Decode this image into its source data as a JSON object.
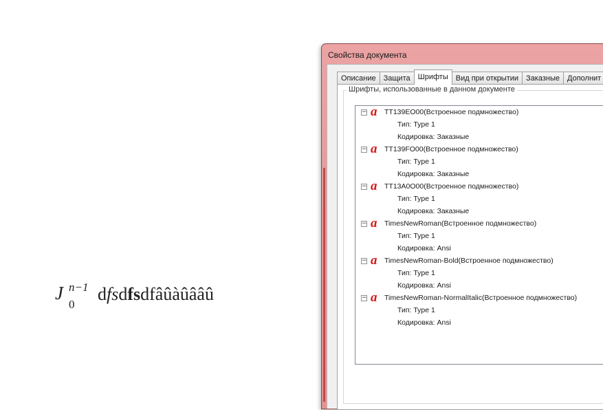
{
  "document": {
    "formula_base": "J",
    "formula_sup": "n−1",
    "formula_sub": "0",
    "text_d1": "d",
    "text_fs_italic": "fs",
    "text_d2": "d",
    "text_fs_bold": "fs",
    "text_rest": "dfâûàûââû"
  },
  "window": {
    "title": "Свойства документа"
  },
  "tabs": [
    {
      "label": "Описание"
    },
    {
      "label": "Защита"
    },
    {
      "label": "Шрифты"
    },
    {
      "label": "Вид при открытии"
    },
    {
      "label": "Заказные"
    },
    {
      "label": "Дополнит"
    }
  ],
  "active_tab": "Шрифты",
  "groupbox": {
    "caption": "Шрифты, использованные в данном документе"
  },
  "fonts": [
    {
      "name": "TT139EO00(Встроенное подмножество)",
      "type": "Тип: Type 1",
      "encoding": "Кодировка: Заказные"
    },
    {
      "name": "TT139FO00(Встроенное подмножество)",
      "type": "Тип: Type 1",
      "encoding": "Кодировка: Заказные"
    },
    {
      "name": "TT13A0O00(Встроенное подмножество)",
      "type": "Тип: Type 1",
      "encoding": "Кодировка: Заказные"
    },
    {
      "name": "TimesNewRoman(Встроенное подмножество)",
      "type": "Тип: Type 1",
      "encoding": "Кодировка: Ansi"
    },
    {
      "name": "TimesNewRoman-Bold(Встроенное подмножество)",
      "type": "Тип: Type 1",
      "encoding": "Кодировка: Ansi"
    },
    {
      "name": "TimesNewRoman-NormalItalic(Встроенное подмножество)",
      "type": "Тип: Type 1",
      "encoding": "Кодировка: Ansi"
    }
  ],
  "icons": {
    "toggle": "⊟",
    "font_icon": "a"
  },
  "colors": {
    "font_icon": "#d41a1a",
    "window_frame": "#e89a9a"
  }
}
